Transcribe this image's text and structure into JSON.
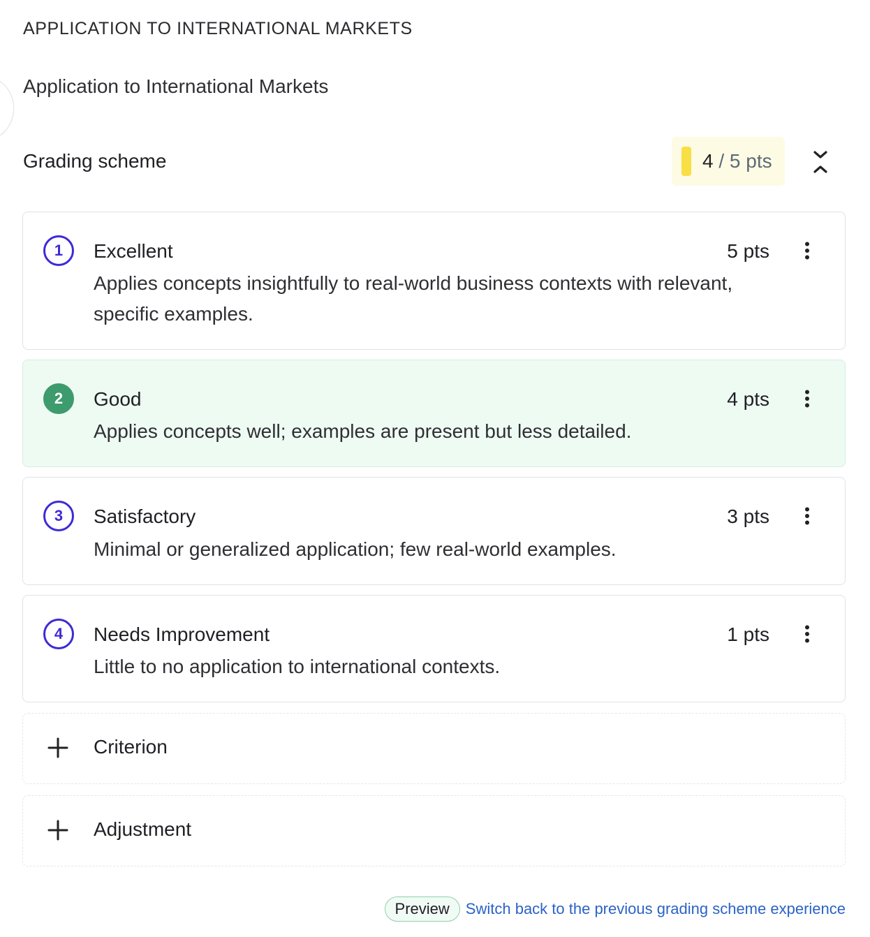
{
  "section": {
    "heading": "APPLICATION TO INTERNATIONAL MARKETS",
    "subtitle": "Application to International Markets"
  },
  "scheme": {
    "title": "Grading scheme",
    "score_value": "4",
    "score_max": " / 5 pts",
    "score_fraction": 0.8,
    "accent_color": "#f7df44"
  },
  "criteria": [
    {
      "number": "1",
      "title": "Excellent",
      "points": "5 pts",
      "description": "Applies concepts insightfully to real-world business contexts with relevant, specific examples.",
      "selected": false
    },
    {
      "number": "2",
      "title": "Good",
      "points": "4 pts",
      "description": "Applies concepts well; examples are present but less detailed.",
      "selected": true
    },
    {
      "number": "3",
      "title": "Satisfactory",
      "points": "3 pts",
      "description": "Minimal or generalized application; few real-world examples.",
      "selected": false
    },
    {
      "number": "4",
      "title": "Needs Improvement",
      "points": "1 pts",
      "description": "Little to no application to international contexts.",
      "selected": false
    }
  ],
  "actions": {
    "add_criterion": "Criterion",
    "add_adjustment": "Adjustment"
  },
  "footer": {
    "preview_badge": "Preview",
    "switch_link": "Switch back to the previous grading scheme experience"
  },
  "colors": {
    "number_ring": "#3d2bd6",
    "selected_number": "#3d9b6e",
    "selected_bg": "#eefbf3",
    "link": "#2b63c6"
  },
  "icons": {
    "collapse": "collapse-chevrons-icon",
    "menu": "more-vertical-icon",
    "add": "plus-icon"
  }
}
